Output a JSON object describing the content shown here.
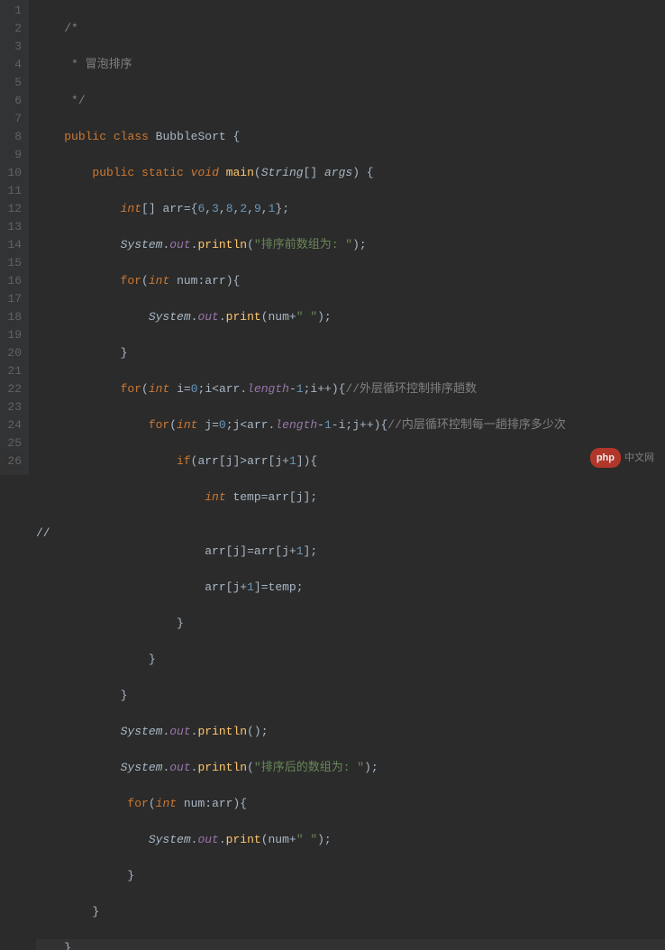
{
  "lines": {
    "1": "1",
    "2": "2",
    "3": "3",
    "4": "4",
    "5": "5",
    "6": "6",
    "7": "7",
    "8": "8",
    "9": "9",
    "10": "10",
    "11": "11",
    "12": "12",
    "13": "13",
    "14": "14",
    "15": "15",
    "16": "16",
    "17": "17",
    "18": "18",
    "19": "19",
    "20": "20",
    "21": "21",
    "22": "22",
    "23": "23",
    "24": "24",
    "25": "25",
    "26": "26"
  },
  "code": {
    "l1": "/*",
    "l2_star": " * ",
    "l2_text": "冒泡排序",
    "l3": " */",
    "l4_public": "public",
    "l4_class": "class",
    "l4_name": "BubbleSort",
    "l4_brace": " {",
    "l5_public": "public",
    "l5_static": "static",
    "l5_void": "void",
    "l5_main": "main",
    "l5_paren_o": "(",
    "l5_string": "String",
    "l5_arr": "[]",
    "l5_args": "args",
    "l5_paren_c": ")",
    "l5_brace": " {",
    "l6_int": "int",
    "l6_arr": "[]",
    "l6_var": "arr",
    "l6_eq": "=",
    "l6_bo": "{",
    "l6_v1": "6",
    "l6_c": ",",
    "l6_v2": "3",
    "l6_v3": "8",
    "l6_v4": "2",
    "l6_v5": "9",
    "l6_v6": "1",
    "l6_bc": "};",
    "l7_sys": "System",
    "l7_out": "out",
    "l7_println": "println",
    "l7_str": "\"排序前数组为: \"",
    "l7_end": ");",
    "l7_dot": ".",
    "l7_po": "(",
    "l8_for": "for",
    "l8_po": "(",
    "l8_int": "int",
    "l8_num": "num",
    "l8_colon": ":",
    "l8_arr": "arr",
    "l8_pc": ")",
    "l8_brace": "{",
    "l9_sys": "System",
    "l9_out": "out",
    "l9_print": "print",
    "l9_dot": ".",
    "l9_po": "(",
    "l9_num": "num",
    "l9_plus": "+",
    "l9_str": "\" \"",
    "l9_end": ");",
    "l10_brace": "}",
    "l11_for": "for",
    "l11_po": "(",
    "l11_int": "int",
    "l11_i": "i",
    "l11_eq": "=",
    "l11_zero": "0",
    "l11_semi": ";",
    "l11_i2": "i",
    "l11_lt": "<",
    "l11_arr": "arr",
    "l11_length": "length",
    "l11_dot": ".",
    "l11_minus": "-",
    "l11_one": "1",
    "l11_i3": "i",
    "l11_pp": "++",
    "l11_pc": ")",
    "l11_brace": "{",
    "l11_com": "//外层循环控制排序趟数",
    "l12_for": "for",
    "l12_po": "(",
    "l12_int": "int",
    "l12_j": "j",
    "l12_eq": "=",
    "l12_zero": "0",
    "l12_semi": ";",
    "l12_j2": "j",
    "l12_lt": "<",
    "l12_arr": "arr",
    "l12_dot": ".",
    "l12_length": "length",
    "l12_minus": "-",
    "l12_one": "1",
    "l12_i": "i",
    "l12_j3": "j",
    "l12_pp": "++",
    "l12_pc": ")",
    "l12_brace": "{",
    "l12_com": "//内层循环控制每一趟排序多少次",
    "l13_if": "if",
    "l13_po": "(",
    "l13_arr1": "arr",
    "l13_bo1": "[",
    "l13_j1": "j",
    "l13_bc1": "]",
    "l13_gt": ">",
    "l13_arr2": "arr",
    "l13_bo2": "[",
    "l13_j2": "j",
    "l13_plus": "+",
    "l13_one": "1",
    "l13_bc2": "]",
    "l13_pc": ")",
    "l13_brace": "{",
    "l14_int": "int",
    "l14_temp": "temp",
    "l14_eq": "=",
    "l14_arr": "arr",
    "l14_bo": "[",
    "l14_j": "j",
    "l14_bc": "];",
    "l15_arr1": "arr",
    "l15_bo1": "[",
    "l15_j1": "j",
    "l15_bc1": "]",
    "l15_eq": "=",
    "l15_arr2": "arr",
    "l15_bo2": "[",
    "l15_j2": "j",
    "l15_plus": "+",
    "l15_one": "1",
    "l15_bc2": "];",
    "l16_arr": "arr",
    "l16_bo": "[",
    "l16_j": "j",
    "l16_plus": "+",
    "l16_one": "1",
    "l16_bc": "]",
    "l16_eq": "=",
    "l16_temp": "temp",
    "l16_semi": ";",
    "l17_brace": "}",
    "l18_brace": "}",
    "l19_brace": "}",
    "l20_sys": "System",
    "l20_out": "out",
    "l20_println": "println",
    "l20_dot": ".",
    "l20_po": "(",
    "l20_end": ");",
    "l21_sys": "System",
    "l21_out": "out",
    "l21_println": "println",
    "l21_dot": ".",
    "l21_po": "(",
    "l21_str": "\"排序后的数组为: \"",
    "l21_end": ");",
    "l22_for": "for",
    "l22_po": "(",
    "l22_int": "int",
    "l22_num": "num",
    "l22_colon": ":",
    "l22_arr": "arr",
    "l22_pc": ")",
    "l22_brace": "{",
    "l23_sys": "System",
    "l23_out": "out",
    "l23_print": "print",
    "l23_dot": ".",
    "l23_po": "(",
    "l23_num": "num",
    "l23_plus": "+",
    "l23_str": "\" \"",
    "l23_end": ");",
    "l24_brace": "}",
    "l25_brace": "}",
    "l26_brace": "}"
  },
  "watermark": {
    "badge": "php",
    "text": "中文网"
  }
}
